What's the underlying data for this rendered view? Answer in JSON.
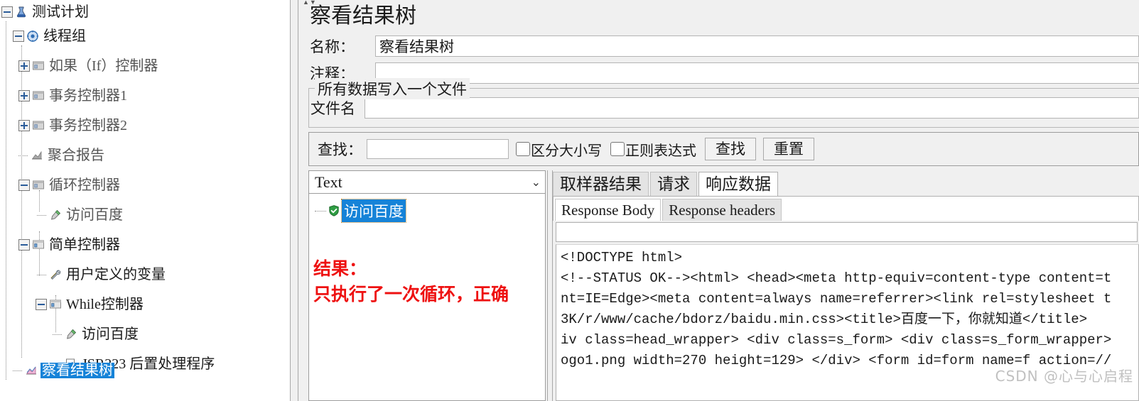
{
  "tree": {
    "items": [
      {
        "label": "测试计划",
        "icon": "test-plan-icon",
        "indent": 0,
        "toggle": "minus",
        "selected": false,
        "dark": true
      },
      {
        "label": "线程组",
        "icon": "thread-group-icon",
        "indent": 1,
        "toggle": "minus",
        "selected": false,
        "dark": true
      },
      {
        "label": "如果（If）控制器",
        "icon": "controller-icon",
        "indent": 2,
        "toggle": "plus",
        "selected": false,
        "dark": false
      },
      {
        "label": "事务控制器1",
        "icon": "controller-icon",
        "indent": 2,
        "toggle": "plus",
        "selected": false,
        "dark": false
      },
      {
        "label": "事务控制器2",
        "icon": "controller-icon",
        "indent": 2,
        "toggle": "plus",
        "selected": false,
        "dark": false
      },
      {
        "label": "聚合报告",
        "icon": "aggregate-report-icon",
        "indent": 2,
        "toggle": "none",
        "selected": false,
        "dark": false
      },
      {
        "label": "循环控制器",
        "icon": "controller-icon",
        "indent": 2,
        "toggle": "minus",
        "selected": false,
        "dark": false
      },
      {
        "label": "访问百度",
        "icon": "sampler-icon",
        "indent": 3,
        "toggle": "none",
        "selected": false,
        "dark": false
      },
      {
        "label": "简单控制器",
        "icon": "controller-icon",
        "indent": 2,
        "toggle": "minus",
        "selected": false,
        "dark": true
      },
      {
        "label": "用户定义的变量",
        "icon": "user-variables-icon",
        "indent": 3,
        "toggle": "none",
        "selected": false,
        "dark": true
      },
      {
        "label": "While控制器",
        "icon": "controller-icon",
        "indent": 3,
        "toggle": "minus",
        "selected": false,
        "dark": true
      },
      {
        "label": "访问百度",
        "icon": "sampler-icon",
        "indent": 4,
        "toggle": "none",
        "selected": false,
        "dark": true
      },
      {
        "label": "JSR223 后置处理程序",
        "icon": "post-processor-icon",
        "indent": 4,
        "toggle": "none",
        "selected": false,
        "dark": true
      },
      {
        "label": "察看结果树",
        "icon": "view-results-tree-icon",
        "indent": 1,
        "toggle": "none",
        "selected": true,
        "dark": true
      }
    ]
  },
  "panel": {
    "title": "察看结果树",
    "name_label": "名称：",
    "name_value": "察看结果树",
    "comment_label": "注释：",
    "comment_value": "",
    "comment_placeholder": "",
    "file_group_title": "所有数据写入一个文件",
    "filename_label": "文件名",
    "filename_value": "",
    "filename_placeholder": ""
  },
  "search": {
    "label": "查找：",
    "value": "",
    "placeholder": "",
    "case_sensitive_label": "区分大小写",
    "case_sensitive_checked": false,
    "regex_label": "正则表达式",
    "regex_checked": false,
    "find_button": "查找",
    "reset_button": "重置"
  },
  "results": {
    "renderer_selected": "Text",
    "item_label": "访问百度",
    "item_status": "success",
    "annotation_line1": "结果：",
    "annotation_line2": "只执行了一次循环，正确",
    "annotation_color": "#ee1111"
  },
  "data_tabs": {
    "tabs": [
      {
        "label": "取样器结果",
        "active": false
      },
      {
        "label": "请求",
        "active": false
      },
      {
        "label": "响应数据",
        "active": true
      }
    ],
    "subtabs": [
      {
        "label": "Response Body",
        "active": true
      },
      {
        "label": "Response headers",
        "active": false
      }
    ],
    "find_field_value": ""
  },
  "response_body": {
    "lines": [
      "<!DOCTYPE html>",
      "<!--STATUS OK--><html> <head><meta http-equiv=content-type content=t",
      "nt=IE=Edge><meta content=always name=referrer><link rel=stylesheet t",
      "3K/r/www/cache/bdorz/baidu.min.css><title>百度一下，你就知道</title>",
      "iv class=head_wrapper> <div class=s_form> <div class=s_form_wrapper>",
      "ogo1.png width=270 height=129> </div> <form id=form name=f action=//"
    ]
  },
  "watermark": {
    "text": "CSDN @心与心启程"
  }
}
